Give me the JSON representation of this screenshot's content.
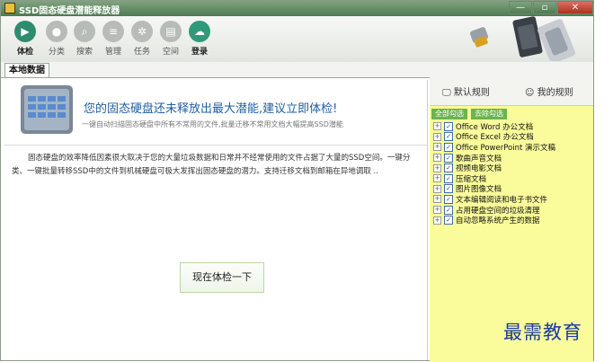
{
  "window": {
    "title": "SSD固态硬盘潜能释放器"
  },
  "toolbar": {
    "items": [
      {
        "label": "体检",
        "icon": "play-icon"
      },
      {
        "label": "分类",
        "icon": "location-icon"
      },
      {
        "label": "搜索",
        "icon": "search-icon"
      },
      {
        "label": "管理",
        "icon": "list-icon"
      },
      {
        "label": "任务",
        "icon": "gear-icon"
      },
      {
        "label": "空间",
        "icon": "storage-icon"
      },
      {
        "label": "登录",
        "icon": "cloud-icon"
      }
    ]
  },
  "tabs": {
    "local": "本地数据"
  },
  "banner": {
    "title": "您的固态硬盘还未释放出最大潜能,建议立即体检!",
    "subtitle": "一键自动扫描固态硬盘中所有不常用的文件,批量迁移不常用文档大幅提高SSD潜能"
  },
  "description": "固态硬盘的效率降低因素很大取决于您的大量垃圾数据和日常并不经常使用的文件占据了大量的SSD空间。一键分类、一键批量转移SSD中的文件到机械硬盘可极大发挥出固态硬盘的潜力。支持迁移文档到邮箱在异地调取 ..",
  "check_button": "现在体检一下",
  "side": {
    "tab_default": "默认规则",
    "tab_mine": "我的规则",
    "select_all": "全部勾选",
    "deselect_all": "去除勾选",
    "rules": [
      "Office Word 办公文档",
      "Office Excel 办公文档",
      "Office PowerPoint 演示文稿",
      "歌曲声音文档",
      "视频电影文档",
      "压缩文档",
      "图片图像文档",
      "文本编辑阅读和电子书文件",
      "占用硬盘空间的垃圾清理",
      "自动忽略系统产生的数据"
    ]
  },
  "watermark": "最需教育",
  "colors": {
    "titlebar": "#5f8a62",
    "accent": "#2f8c6f",
    "side_bg": "#fafb9a",
    "title_blue": "#1f5fa0",
    "checkbox_green": "#6cb44c"
  }
}
